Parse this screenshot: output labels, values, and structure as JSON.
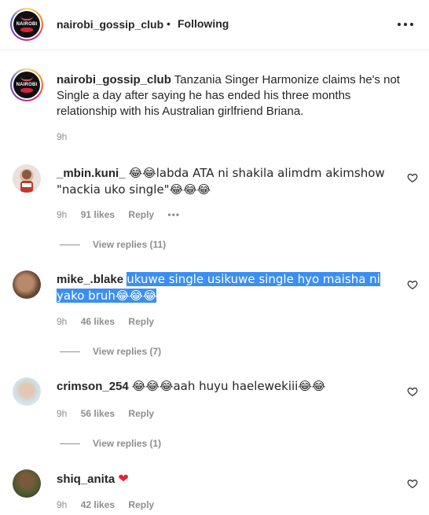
{
  "header": {
    "username": "nairobi_gossip_club",
    "separator": "•",
    "follow_status": "Following",
    "logo_text": "NAIROBI"
  },
  "caption": {
    "username": "nairobi_gossip_club",
    "text": "Tanzania Singer Harmonize claims he's not Single a day after saying he has ended his three months relationship with his Australian girlfriend Briana.",
    "time": "9h"
  },
  "comments": [
    {
      "username": "_mbin.kuni_",
      "text_before": "😂😂labda ATA ni shakila alimdm akimshow \"nackia uko single\"😂😂😂",
      "time": "9h",
      "likes": "91 likes",
      "reply": "Reply",
      "more": "•••",
      "view_replies": "View replies (11)"
    },
    {
      "username": "mike_.blake",
      "text_selected": "ukuwe single usikuwe single hyo maisha ni yako bruh😂😂😂",
      "time": "9h",
      "likes": "46 likes",
      "reply": "Reply",
      "view_replies": "View replies (7)"
    },
    {
      "username": "crimson_254",
      "text_before": "😂😂😂aah huyu haelewekiii😂😂",
      "time": "9h",
      "likes": "56 likes",
      "reply": "Reply",
      "view_replies": "View replies (1)"
    },
    {
      "username": "shiq_anita",
      "text_before": "❤",
      "time": "9h",
      "likes": "42 likes",
      "reply": "Reply"
    }
  ],
  "colors": {
    "selection": "#3b8ef2",
    "secondary_text": "#8e8e8e",
    "heart_red": "#e6223a"
  },
  "icons": {
    "more_options": "more-horizontal-icon",
    "like": "heart-outline-icon"
  }
}
